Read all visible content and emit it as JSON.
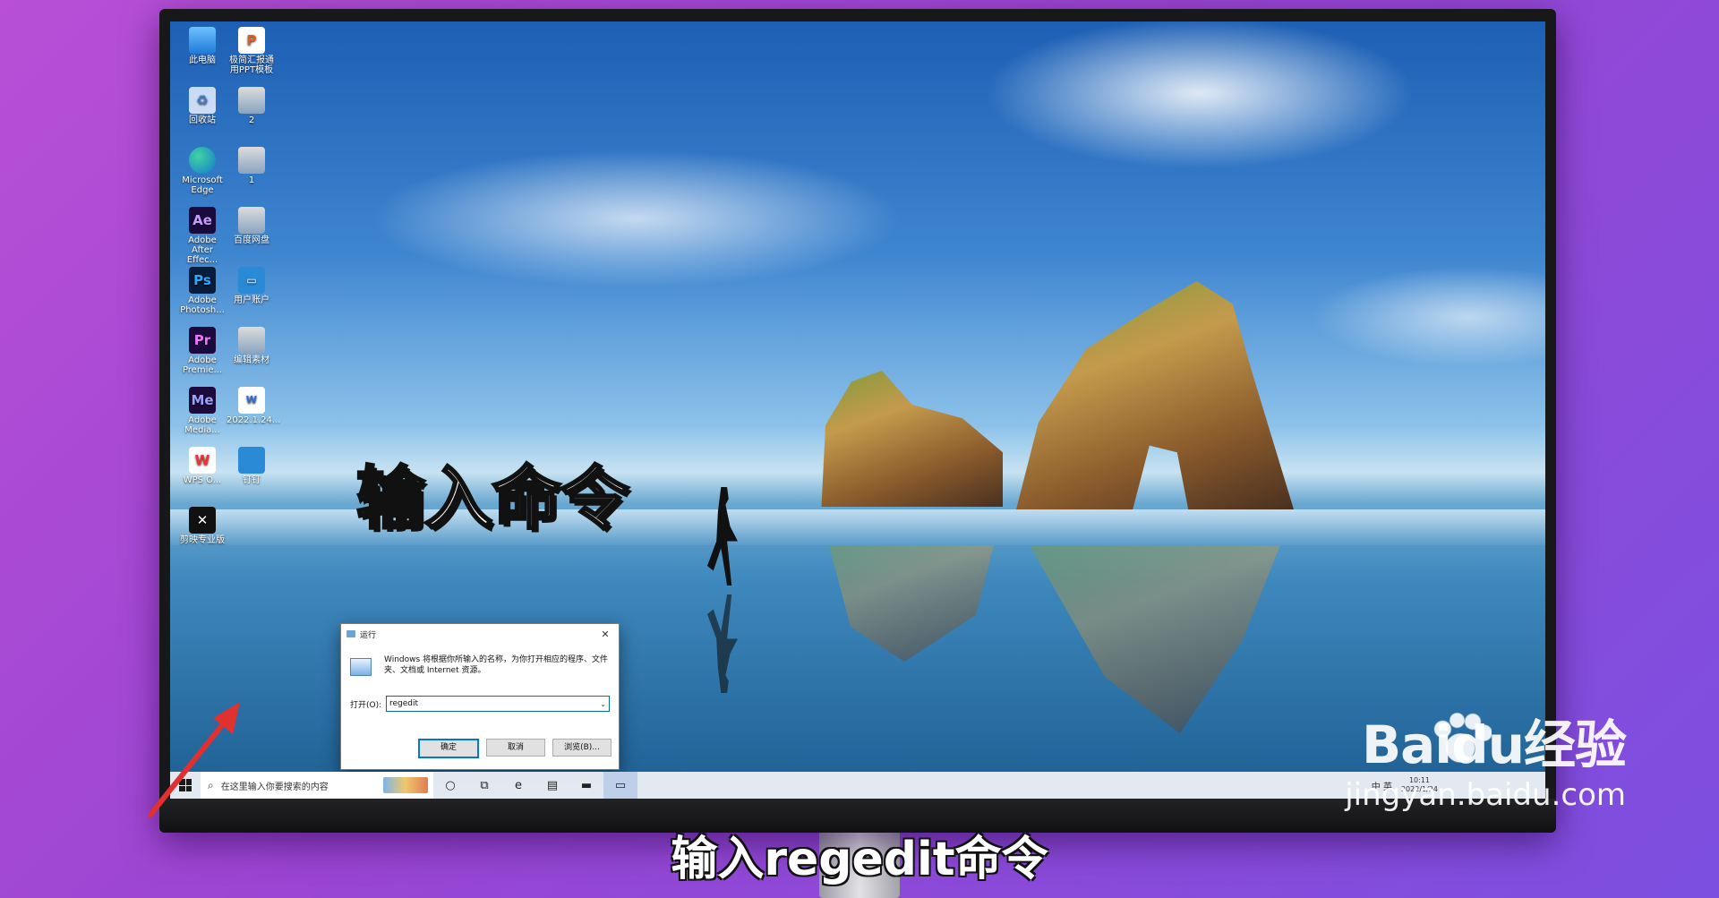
{
  "overlay_title": "输入命令",
  "subtitle": "输入regedit命令",
  "watermark": {
    "logo": "Baidu经验",
    "domain": "jingyan.baidu.com"
  },
  "desktop_icons": [
    {
      "label": "此电脑",
      "icon": "pc-icon",
      "glyph": ""
    },
    {
      "label": "极简汇报通用PPT模板",
      "icon": "ppt-file-icon",
      "glyph": "P"
    },
    {
      "label": "回收站",
      "icon": "recycle-bin-icon",
      "glyph": "♻"
    },
    {
      "label": "2",
      "icon": "image-file-icon",
      "glyph": ""
    },
    {
      "label": "Microsoft Edge",
      "icon": "edge-icon",
      "glyph": ""
    },
    {
      "label": "1",
      "icon": "image-file-icon",
      "glyph": ""
    },
    {
      "label": "Adobe After Effec...",
      "icon": "after-effects-icon",
      "glyph": "Ae"
    },
    {
      "label": "百度网盘",
      "icon": "image-file-icon",
      "glyph": ""
    },
    {
      "label": "Adobe Photosh...",
      "icon": "photoshop-icon",
      "glyph": "Ps"
    },
    {
      "label": "用户账户",
      "icon": "web-shortcut-icon",
      "glyph": "▭"
    },
    {
      "label": "Adobe Premie...",
      "icon": "premiere-icon",
      "glyph": "Pr"
    },
    {
      "label": "编辑素材",
      "icon": "image-file-icon",
      "glyph": ""
    },
    {
      "label": "Adobe Media...",
      "icon": "media-encoder-icon",
      "glyph": "Me"
    },
    {
      "label": "2022.1.24...",
      "icon": "doc-file-icon",
      "glyph": "W"
    },
    {
      "label": "WPS O...",
      "icon": "wps-icon",
      "glyph": "W"
    },
    {
      "label": "钉钉",
      "icon": "dingtalk-icon",
      "glyph": ""
    },
    {
      "label": "剪映专业版",
      "icon": "capcut-icon",
      "glyph": "✕"
    }
  ],
  "run_dialog": {
    "title": "运行",
    "description": "Windows 将根据你所输入的名称，为你打开相应的程序、文件夹、文档或 Internet 资源。",
    "open_label": "打开(O):",
    "input_value": "regedit",
    "ok_label": "确定",
    "cancel_label": "取消",
    "browse_label": "浏览(B)..."
  },
  "taskbar": {
    "search_placeholder": "在这里输入你要搜索的内容",
    "items": [
      {
        "name": "cortana-icon",
        "glyph": "○"
      },
      {
        "name": "task-view-icon",
        "glyph": "⧉"
      },
      {
        "name": "edge-taskbar-icon",
        "glyph": "e"
      },
      {
        "name": "app-taskbar-icon",
        "glyph": "▤"
      },
      {
        "name": "file-explorer-icon",
        "glyph": "▬"
      },
      {
        "name": "run-taskbar-icon",
        "glyph": "▭"
      }
    ],
    "tray_lang": "中 英",
    "clock_time": "10:11",
    "clock_date": "2022/1/24"
  },
  "colors": {
    "arrow": "#e03030",
    "dialog_accent": "#0078d7"
  }
}
